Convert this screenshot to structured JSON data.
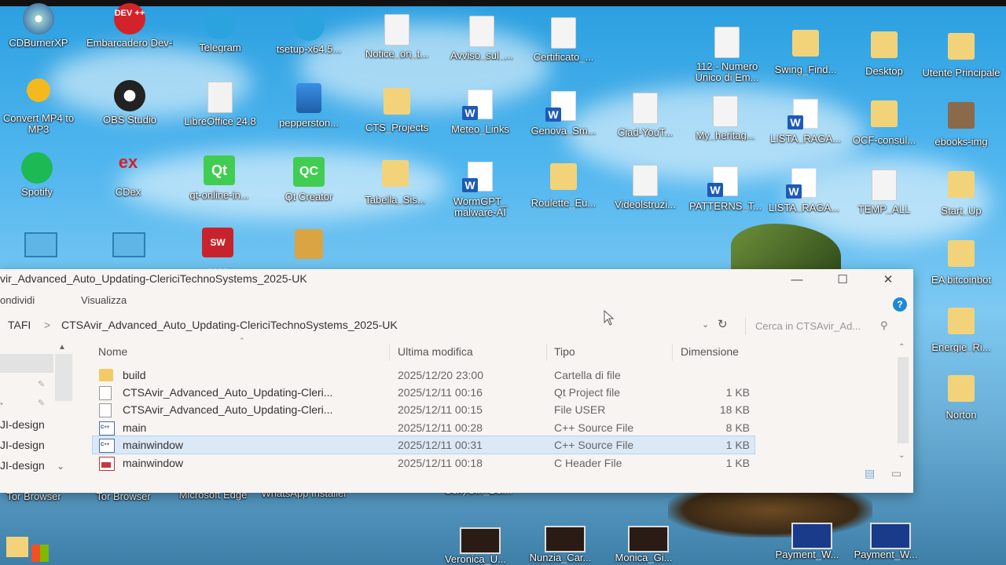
{
  "desktop": {
    "row1": [
      {
        "label": "CDBurnerXP",
        "icon": "disc-icon"
      },
      {
        "label": "Embarcadero Dev-C++",
        "icon": "devcpp-icon",
        "badge": "DEV ++"
      },
      {
        "label": "Telegram",
        "icon": "telegram-icon"
      },
      {
        "label": "tsetup-x64.5...",
        "icon": "telegram-setup-icon"
      },
      {
        "label": "Notice_on_t...",
        "icon": "document-icon"
      },
      {
        "label": "Avviso_sul_...",
        "icon": "document-icon"
      },
      {
        "label": "Certificato_...",
        "icon": "document-icon"
      },
      {
        "label": "112 - Numero Unico di Em...",
        "icon": "document-icon"
      },
      {
        "label": "Swing_Find...",
        "icon": "folder-icon"
      },
      {
        "label": "Desktop",
        "icon": "folder-icon"
      },
      {
        "label": "Utente Principale",
        "icon": "user-folder-icon"
      }
    ],
    "row2": [
      {
        "label": "Convert MP4 to MP3",
        "icon": "music-icon"
      },
      {
        "label": "OBS Studio",
        "icon": "obs-icon"
      },
      {
        "label": "LibreOffice 24.8",
        "icon": "libreoffice-icon"
      },
      {
        "label": "pepperston...",
        "icon": "installer-icon"
      },
      {
        "label": "CTS_Projects",
        "icon": "folder-icon"
      },
      {
        "label": "Meteo_Links",
        "icon": "word-icon"
      },
      {
        "label": "Genova_Sm...",
        "icon": "word-icon"
      },
      {
        "label": "Ciad-YouT...",
        "icon": "document-icon"
      },
      {
        "label": "My_heritag...",
        "icon": "document-icon"
      },
      {
        "label": "LISTA_RAGA...",
        "icon": "word-icon"
      },
      {
        "label": "OCF-consul...",
        "icon": "folder-icon"
      },
      {
        "label": "ebooks-img",
        "icon": "folder-icon"
      }
    ],
    "row3": [
      {
        "label": "Spotify",
        "icon": "spotify-icon"
      },
      {
        "label": "CDex",
        "icon": "cdex-icon"
      },
      {
        "label": "qt-online-in...",
        "icon": "qt-icon",
        "badge": "Qt"
      },
      {
        "label": "Qt Creator",
        "icon": "qt-creator-icon",
        "badge": "QC"
      },
      {
        "label": "Tabella_Sis...",
        "icon": "folder-icon"
      },
      {
        "label": "WormGPT_ malware-AI",
        "icon": "word-icon"
      },
      {
        "label": "Roulette_Eu...",
        "icon": "folder-icon"
      },
      {
        "label": "Videolstruzi...",
        "icon": "document-icon"
      },
      {
        "label": "PATTERNS_T...",
        "icon": "word-icon"
      },
      {
        "label": "LISTA_RAGA...",
        "icon": "word-icon"
      },
      {
        "label": "TEMP_ALL",
        "icon": "document-icon"
      },
      {
        "label": "Start_Up",
        "icon": "folder-icon"
      }
    ],
    "row4_badges": {
      "solidworks": "SW 2022"
    },
    "right_side": [
      {
        "label": "EA bitcoinbot",
        "icon": "folder-icon"
      },
      {
        "label": "Energie_Ri...",
        "icon": "folder-icon"
      },
      {
        "label": "Norton",
        "icon": "norton-icon"
      }
    ],
    "bottom": [
      {
        "label": "Tor Browser",
        "icon": "tor-icon"
      },
      {
        "label": "Tor Browser",
        "icon": "tor-icon"
      },
      {
        "label": "Microsoft Edge",
        "icon": "edge-icon"
      },
      {
        "label": "WhatsApp Installer",
        "icon": "whatsapp-icon"
      },
      {
        "label": "SexyGirl_Bel...",
        "icon": "image-icon"
      },
      {
        "label": "Veronica_U...",
        "icon": "image-icon"
      },
      {
        "label": "Nunzia_Car...",
        "icon": "image-icon"
      },
      {
        "label": "Monica_Gi...",
        "icon": "image-icon"
      },
      {
        "label": "Payment_W...",
        "icon": "image-icon"
      },
      {
        "label": "Payment_W...",
        "icon": "image-icon"
      }
    ]
  },
  "window": {
    "title": "vir_Advanced_Auto_Updating-ClericiTechnoSystems_2025-UK",
    "controls": {
      "minimize": "—",
      "maximize": "☐",
      "close": "✕"
    },
    "ribbon": {
      "share": "ondividi",
      "view": "Visualizza"
    },
    "help": "?",
    "address": {
      "parent": "TAFI",
      "separator": ">",
      "current": "CTSAvir_Advanced_Auto_Updating-ClericiTechnoSystems_2025-UK"
    },
    "search_placeholder": "Cerca in CTSAvir_Ad...",
    "nav": [
      "JI-design",
      "JI-design",
      "JI-design"
    ],
    "columns": {
      "name": "Nome",
      "modified": "Ultima modifica",
      "type": "Tipo",
      "size": "Dimensione"
    },
    "files": [
      {
        "name": "build",
        "modified": "2025/12/20 23:00",
        "type": "Cartella di file",
        "size": "",
        "icon": "folder-icon",
        "selected": false
      },
      {
        "name": "CTSAvir_Advanced_Auto_Updating-Cleri...",
        "modified": "2025/12/11 00:16",
        "type": "Qt Project file",
        "size": "1 KB",
        "icon": "qt-project-icon",
        "selected": false
      },
      {
        "name": "CTSAvir_Advanced_Auto_Updating-Cleri...",
        "modified": "2025/12/11 00:15",
        "type": "File USER",
        "size": "18 KB",
        "icon": "file-icon",
        "selected": false
      },
      {
        "name": "main",
        "modified": "2025/12/11 00:28",
        "type": "C++ Source File",
        "size": "8 KB",
        "icon": "cpp-file-icon",
        "selected": false
      },
      {
        "name": "mainwindow",
        "modified": "2025/12/11 00:31",
        "type": "C++ Source File",
        "size": "1 KB",
        "icon": "cpp-file-icon",
        "selected": true
      },
      {
        "name": "mainwindow",
        "modified": "2025/12/11 00:18",
        "type": "C Header File",
        "size": "1 KB",
        "icon": "header-file-icon",
        "selected": false
      }
    ]
  }
}
